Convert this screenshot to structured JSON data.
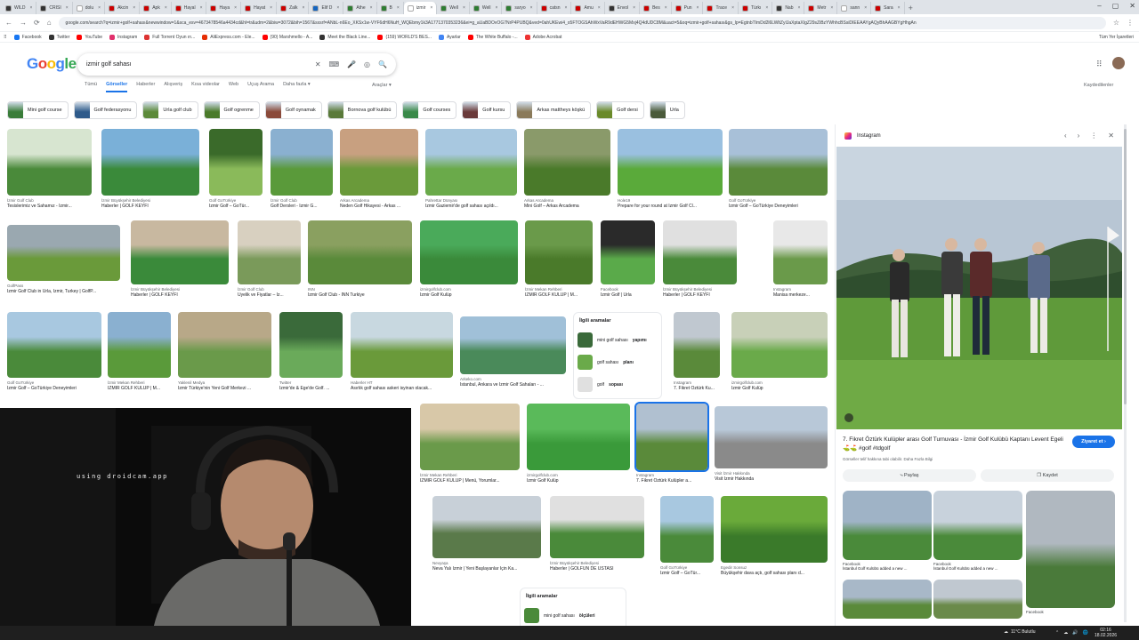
{
  "browser": {
    "tabs": [
      {
        "label": "WILD",
        "color": "#333"
      },
      {
        "label": "CRISI",
        "color": "#333"
      },
      {
        "label": "dolu",
        "color": "#fff"
      },
      {
        "label": "Akcin",
        "color": "#c00"
      },
      {
        "label": "Apk",
        "color": "#c00"
      },
      {
        "label": "Hayal",
        "color": "#c00"
      },
      {
        "label": "Haya",
        "color": "#c00"
      },
      {
        "label": "Hayat",
        "color": "#c00"
      },
      {
        "label": "Zalk",
        "color": "#c00"
      },
      {
        "label": "Elif D",
        "color": "#1565c0"
      },
      {
        "label": "Athe",
        "color": "#2e7d32"
      },
      {
        "label": "B",
        "color": "#2e7d32"
      },
      {
        "label": "izmir",
        "color": "#fff"
      },
      {
        "label": "Well",
        "color": "#2e7d32"
      },
      {
        "label": "Well",
        "color": "#2e7d32"
      },
      {
        "label": "saryo",
        "color": "#2e7d32"
      },
      {
        "label": "catsn",
        "color": "#c00"
      },
      {
        "label": "Amu",
        "color": "#c00"
      },
      {
        "label": "Envol",
        "color": "#333"
      },
      {
        "label": "Bes",
        "color": "#c00"
      },
      {
        "label": "Pun",
        "color": "#c00"
      },
      {
        "label": "Trace",
        "color": "#c00"
      },
      {
        "label": "Türkı",
        "color": "#c00"
      },
      {
        "label": "Nab",
        "color": "#333"
      },
      {
        "label": "Metr",
        "color": "#c00"
      },
      {
        "label": "sann",
        "color": "#fff"
      },
      {
        "label": "Sara",
        "color": "#c00"
      }
    ],
    "active_tab_index": 12,
    "new_tab_glyph": "+",
    "close_glyph": "×",
    "window_controls": [
      "–",
      "▢",
      "✕"
    ],
    "nav_glyphs": [
      "←",
      "→",
      "⟳",
      "⌂"
    ],
    "right_glyphs": [
      "☆",
      "⋮"
    ],
    "url": "google.com/search?q=izmir+golf+sahası&newwindow=1&sca_esv=4673478546a4434cd&hl=tr&udm=2&biw=3072&bih=1567&sxsrf=ANbL-n6Eo_XKSx1w-VYF6dH6NuH_WQEbmy1k3A1771370353236&ei=g_aUaBDOvOG7NrP4PUBQ&ved=0ahUKEwi4_o5FTOGSAhWxVaR9dEHWG5Mxj4Q4dUDC8M&uact=5&oq=izmir+golf+sahası&gs_lp=EgtnbTImDd2l6LWltZyIJaXptaXIgZ29sZiBzYWhhcBSsiDIEEAAYgAQyBhAAGBYgHhgAn",
    "bookmarks": [
      {
        "label": "Facebook",
        "color": "#1877f2"
      },
      {
        "label": "Twitter",
        "color": "#333"
      },
      {
        "label": "YouTube",
        "color": "#f00"
      },
      {
        "label": "Instagram",
        "color": "#e1306c"
      },
      {
        "label": "Full Torrent Oyun ın...",
        "color": "#d33"
      },
      {
        "label": "AliExpress.com - Ele...",
        "color": "#e62e04"
      },
      {
        "label": "(90) Marshmello - A...",
        "color": "#f00"
      },
      {
        "label": "Meet the Black Line...",
        "color": "#333"
      },
      {
        "label": "(159) WORLD'S BES...",
        "color": "#f00"
      },
      {
        "label": "Ayarlar",
        "color": "#4285f4"
      },
      {
        "label": "The White Buffalo -...",
        "color": "#f00"
      },
      {
        "label": "Adobe Acrobat",
        "color": "#e33"
      }
    ],
    "all_bookmarks": "Tüm Yer İşaretleri"
  },
  "search": {
    "logo": [
      "G",
      "o",
      "o",
      "g",
      "le"
    ],
    "query": "izmir golf sahası",
    "icons": [
      "✕",
      "⌨",
      "🎤",
      "◎",
      "🔍"
    ],
    "apps_glyph": "⠿",
    "filters": [
      "Tümü",
      "Görseller",
      "Haberler",
      "Alışveriş",
      "Kısa videolar",
      "Web",
      "Uçuş Arama",
      "Daha fazla ▾"
    ],
    "selected_filter": 1,
    "tools": "Araçlar ▾",
    "saved": "Kaydedilenler",
    "chips": [
      {
        "label": "Mini golf course",
        "color": "#3a7d3a"
      },
      {
        "label": "Golf federasyonu",
        "color": "#2e5a8a"
      },
      {
        "label": "Urla golf club",
        "color": "#5c8a3a"
      },
      {
        "label": "Golf ogrenme",
        "color": "#4a7a2a"
      },
      {
        "label": "Golf oynamak",
        "color": "#8a4a3a"
      },
      {
        "label": "Bornova golf kulübü",
        "color": "#5a7a3a"
      },
      {
        "label": "Golf courses",
        "color": "#3a8a4a"
      },
      {
        "label": "Golf kursu",
        "color": "#6a3a3a"
      },
      {
        "label": "Arkas mattheys köşkü",
        "color": "#8a7a5a"
      },
      {
        "label": "Golf dersi",
        "color": "#6a8a2a"
      },
      {
        "label": "Urla",
        "color": "#4a5a3a"
      }
    ]
  },
  "results": [
    {
      "src": "İzmir Golf Club",
      "title": "Tesislerimiz ve Sahamız - İzmir...",
      "c1": "#d7e5d0",
      "c2": "#4a8a3a"
    },
    {
      "src": "İzmir Büyükşehir Belediyesi",
      "title": "Haberler | GOLF KEYFİ",
      "c1": "#7ab0d8",
      "c2": "#3a8a3a"
    },
    {
      "src": "Golf GoTürkiye",
      "title": "İzmir Golf – GoTür...",
      "c1": "#3a6a2a",
      "c2": "#8aba5a"
    },
    {
      "src": "İzmir Golf Club",
      "title": "Golf Dersleri - İzmir G...",
      "c1": "#8ab0d0",
      "c2": "#5a9a3a"
    },
    {
      "src": "Arkas Arcadema",
      "title": "Neden Golf Hikayesi - Arkas ...",
      "c1": "#c8a080",
      "c2": "#6a9a3a"
    },
    {
      "src": "Pahrettar Dünyası",
      "title": "İzmir Gaziemir'de golf sahası açıldı...",
      "c1": "#a8c8e0",
      "c2": "#6aaa4a"
    },
    {
      "src": "Arkas Arcadema",
      "title": "Mini Golf – Arkas Arcadema",
      "c1": "#8a9a6a",
      "c2": "#4a7a2a"
    },
    {
      "src": "Hole19",
      "title": "Prepare for your round at İzmir Golf Cl...",
      "c1": "#9ac0e0",
      "c2": "#5aaa3a"
    },
    {
      "src": "Golf GoTürkiye",
      "title": "İzmir Golf – GoTürkiye Deneyimleri",
      "c1": "#a8c0d8",
      "c2": "#5a8a3a"
    },
    {
      "src": "GolfPass",
      "title": "İzmir Golf Club in Urla, İzmir, Turkey | GolfP...",
      "c1": "#9aa8b0",
      "c2": "#6a9a3a"
    },
    {
      "src": "İzmir Büyükşehir Belediyesi",
      "title": "Haberler | GOLF KEYFİ",
      "c1": "#c8b8a0",
      "c2": "#3a8a3a"
    },
    {
      "src": "İzmir Golf Club",
      "title": "Üyelik ve Fiyatlar – İz...",
      "c1": "#d8d0c0",
      "c2": "#7a9a5a"
    },
    {
      "src": "INN",
      "title": "İzmir Golf Club - INN Turkiye",
      "c1": "#8aa060",
      "c2": "#5a8a3a"
    },
    {
      "src": "izmirgolfclub.com",
      "title": "İzmir Golf Kulüp",
      "c1": "#4aaa5a",
      "c2": "#3a8a3a"
    },
    {
      "src": "İzmir Mekan Rehberi",
      "title": "İZMİR GOLF KULÜP | M...",
      "c1": "#6a9a4a",
      "c2": "#4a7a2a"
    },
    {
      "src": "Facebook",
      "title": "İzmir Golf | Urla",
      "c1": "#2a2a2a",
      "c2": "#5aaa4a"
    },
    {
      "src": "İzmir Büyükşehir Belediyesi",
      "title": "Haberler | GOLF KEYFİ",
      "c1": "#e0e0e0",
      "c2": "#4a8a3a"
    },
    {
      "src": "Instagram",
      "title": "Manisa merkeze...",
      "c1": "#e8e8e8",
      "c2": "#6a9a4a"
    },
    {
      "src": "Golf GoTürkiye",
      "title": "İzmir Golf – GoTürkiye Deneyimleri",
      "c1": "#a8c8e0",
      "c2": "#4a8a3a"
    },
    {
      "src": "İzmir Mekan Rehberi",
      "title": "İZMİR GOLF KULÜP | M...",
      "c1": "#8ab0d0",
      "c2": "#5a9a3a"
    },
    {
      "src": "Yaklenil Medya",
      "title": "İzmir Türkiye'nin Yeni Golf Merkezi ...",
      "c1": "#b8a888",
      "c2": "#6a9a4a"
    },
    {
      "src": "Twitter",
      "title": "İzmir'de & Ege'de Golf. ...",
      "c1": "#3a6a3a",
      "c2": "#6aaa5a"
    },
    {
      "src": "Haberler HT",
      "title": "Asırlık golf sahası askeri isyinan olacak...",
      "c1": "#c8d8e0",
      "c2": "#6a9a3a"
    },
    {
      "src": "Arkeko.com",
      "title": "İstanbul, Ankara ve İzmir Golf Sahaları - ...",
      "c1": "#a0c0d8",
      "c2": "#4a8a5a"
    },
    {
      "src": "Instagram",
      "title": "7. Fikret Öztürk Ku...",
      "c1": "#c0c8d0",
      "c2": "#5a8a3a"
    },
    {
      "src": "izmirgolfclub.com",
      "title": "İzmir Golf Kulüp",
      "c1": "#c8d0b8",
      "c2": "#6aaa4a"
    },
    {
      "src": "İzmir Mekan Rehberi",
      "title": "İZMİR GOLF KULÜP | Menü, Yorumlar...",
      "c1": "#d8c8a8",
      "c2": "#6a9a4a"
    },
    {
      "src": "izmirgolfclub.com",
      "title": "İzmir Golf Kulüp",
      "c1": "#5aba5a",
      "c2": "#3a9a3a"
    },
    {
      "src": "Instagram",
      "title": "7. Fikret Öztürk Kulüpler a...",
      "c1": "#b0c0d0",
      "c2": "#5a8a3a"
    },
    {
      "src": "Visit İzmir Hakkında",
      "title": "Visit İzmir Hakkında",
      "c1": "#b8c8d8",
      "c2": "#8a8a8a"
    },
    {
      "src": "Nevyaşa",
      "title": "Neva Yalı İzmir | Yeni Başlayanlar İçin Ka...",
      "c1": "#c8d0d8",
      "c2": "#5a7a4a"
    },
    {
      "src": "İzmir Büyükşehir Belediyesi",
      "title": "Haberler | GOLFÜN DE USTASI",
      "c1": "#e0e0e0",
      "c2": "#4a8a3a"
    },
    {
      "src": "Golf GoTürkiye",
      "title": "İzmir Golf – GoTür...",
      "c1": "#a8c8e0",
      "c2": "#4a8a3a"
    },
    {
      "src": "Egedir Sonsuz",
      "title": "Büyükşehir dava açtı, golf sahası planı d...",
      "c1": "#6aaa3a",
      "c2": "#3a7a2a"
    }
  ],
  "related_searches": {
    "title": "İlgili aramalar",
    "items": [
      {
        "pre": "mini golf sahası ",
        "bold": "yapımı",
        "color": "#3a6a3a"
      },
      {
        "pre": "golf sahası ",
        "bold": "planı",
        "color": "#6aaa4a"
      },
      {
        "pre": "golf ",
        "bold": "sopası",
        "color": "#e0e0e0"
      }
    ]
  },
  "related_searches_2": {
    "title": "İlgili aramalar",
    "items": [
      {
        "pre": "mini golf sahası ",
        "bold": "ölçüleri",
        "color": "#4a8a3a"
      }
    ]
  },
  "panel": {
    "source": "Instagram",
    "controls": [
      "‹",
      "›",
      "⋮",
      "✕"
    ],
    "title": "7. Fikret Öztürk Kulüpler arası Golf Turnuvası - İzmir Golf Kulübü Kaptanı Levent Egeli ⛳⛳ #golf #tdgolf",
    "visit": "Ziyaret et ›",
    "note": "Görseller telif hakkına tabi olabilir. Daha Fazla Bilgi",
    "share": "⤷ Paylaş",
    "save": "❐ Kaydet",
    "related": [
      {
        "src": "Facebook",
        "title": "İstanbul Golf Kulübü added a new ..."
      },
      {
        "src": "Facebook",
        "title": "İstanbul Golf Kulübü added a new ..."
      },
      {
        "src": "Facebook",
        "title": ""
      },
      {
        "src": "",
        "title": ""
      },
      {
        "src": "",
        "title": ""
      }
    ]
  },
  "webcam": {
    "watermark": "using droidcam.app"
  },
  "taskbar": {
    "weather": "11°C Bulutlu",
    "tray": [
      "⌃",
      "☁",
      "🔊",
      "🌐"
    ],
    "time": "02:16",
    "date": "18.02.2026"
  }
}
